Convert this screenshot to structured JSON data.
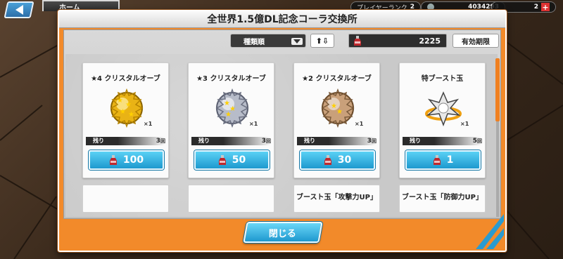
{
  "topbar": {
    "home_label": "ホーム",
    "rank_label": "プレイヤーランク",
    "rank_value": "2",
    "coin_value": "4034293",
    "gem_value": "2"
  },
  "modal": {
    "title": "全世界1.5億DL記念コーラ交換所",
    "sort_label": "種類順",
    "order_label": "⬆⇩",
    "cola_count": "2225",
    "validity_label": "有効期限",
    "close_label": "閉じる"
  },
  "cards": [
    {
      "name": "★4 クリスタルオーブ",
      "qty": "×1",
      "remain_label": "残り",
      "remain": "3",
      "unit": "回",
      "price": "100",
      "orb": "gold"
    },
    {
      "name": "★3 クリスタルオーブ",
      "qty": "×1",
      "remain_label": "残り",
      "remain": "3",
      "unit": "回",
      "price": "50",
      "orb": "silver"
    },
    {
      "name": "★2 クリスタルオーブ",
      "qty": "×1",
      "remain_label": "残り",
      "remain": "3",
      "unit": "回",
      "price": "30",
      "orb": "bronze"
    },
    {
      "name": "特ブースト玉",
      "qty": "×1",
      "remain_label": "残り",
      "remain": "5",
      "unit": "回",
      "price": "1",
      "orb": "boost"
    }
  ],
  "partial_cards": [
    {
      "name": ""
    },
    {
      "name": ""
    },
    {
      "name": "ブースト玉「攻撃力UP」"
    },
    {
      "name": "ブースト玉「防御力UP」"
    }
  ],
  "colors": {
    "frame": "#f28a2a",
    "button": "#1d99cf",
    "accent": "#f08020"
  }
}
